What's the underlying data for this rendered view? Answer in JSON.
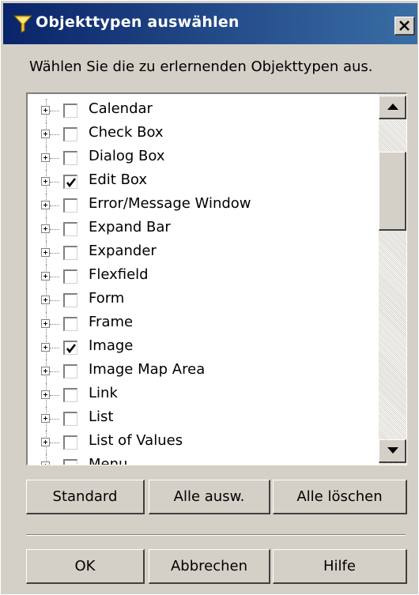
{
  "window": {
    "title": "Objekttypen auswählen",
    "icon": "filter-funnel-icon"
  },
  "instruction": "Wählen Sie die zu erlernenden Objekttypen aus.",
  "object_types": [
    {
      "label": "Calendar",
      "checked": false
    },
    {
      "label": "Check Box",
      "checked": false
    },
    {
      "label": "Dialog Box",
      "checked": false
    },
    {
      "label": "Edit Box",
      "checked": true
    },
    {
      "label": "Error/Message Window",
      "checked": false
    },
    {
      "label": "Expand Bar",
      "checked": false
    },
    {
      "label": "Expander",
      "checked": false
    },
    {
      "label": "Flexfield",
      "checked": false
    },
    {
      "label": "Form",
      "checked": false
    },
    {
      "label": "Frame",
      "checked": false
    },
    {
      "label": "Image",
      "checked": true
    },
    {
      "label": "Image Map Area",
      "checked": false
    },
    {
      "label": "Link",
      "checked": false
    },
    {
      "label": "List",
      "checked": false
    },
    {
      "label": "List of Values",
      "checked": false
    },
    {
      "label": "Menu",
      "checked": false
    }
  ],
  "buttons": {
    "standard": "Standard",
    "select_all": "Alle ausw.",
    "clear_all": "Alle löschen",
    "ok": "OK",
    "cancel": "Abbrechen",
    "help": "Hilfe"
  }
}
